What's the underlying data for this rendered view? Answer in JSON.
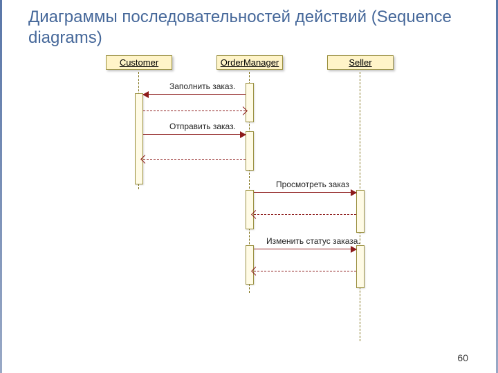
{
  "title": "Диаграммы последовательностей действий (Sequence diagrams)",
  "page_number": "60",
  "participants": {
    "p0": "Customer",
    "p1": "OrderManager",
    "p2": "Seller"
  },
  "messages": {
    "m1": "Заполнить заказ.",
    "m2": "Отправить заказ.",
    "m3": "Просмотреть заказ",
    "m4": "Изменить статус заказа."
  },
  "chart_data": {
    "type": "sequence_diagram",
    "participants": [
      "Customer",
      "OrderManager",
      "Seller"
    ],
    "messages": [
      {
        "from": "OrderManager",
        "to": "Customer",
        "label": "Заполнить заказ.",
        "kind": "call"
      },
      {
        "from": "Customer",
        "to": "OrderManager",
        "label": "",
        "kind": "return"
      },
      {
        "from": "Customer",
        "to": "OrderManager",
        "label": "Отправить заказ.",
        "kind": "call"
      },
      {
        "from": "OrderManager",
        "to": "Customer",
        "label": "",
        "kind": "return"
      },
      {
        "from": "OrderManager",
        "to": "Seller",
        "label": "Просмотреть заказ",
        "kind": "call"
      },
      {
        "from": "Seller",
        "to": "OrderManager",
        "label": "",
        "kind": "return"
      },
      {
        "from": "OrderManager",
        "to": "Seller",
        "label": "Изменить статус заказа.",
        "kind": "call"
      },
      {
        "from": "Seller",
        "to": "OrderManager",
        "label": "",
        "kind": "return"
      }
    ]
  }
}
